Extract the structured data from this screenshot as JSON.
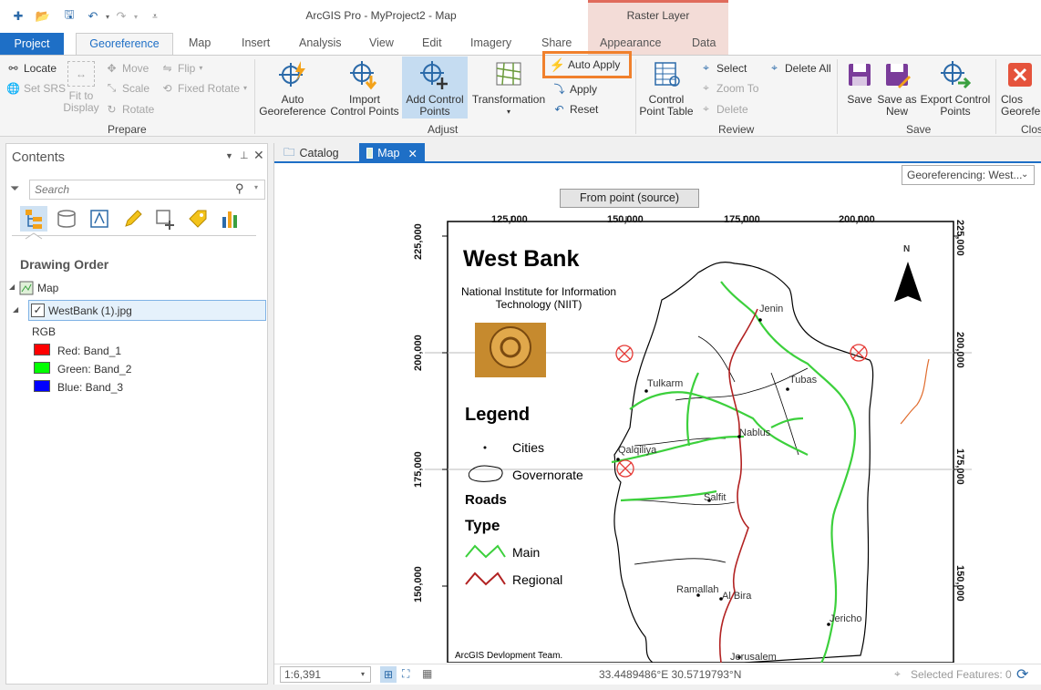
{
  "titlebar": {
    "title": "ArcGIS Pro - MyProject2 - Map",
    "context_group": "Raster Layer"
  },
  "tabs": {
    "project": "Project",
    "items": [
      "Georeference",
      "Map",
      "Insert",
      "Analysis",
      "View",
      "Edit",
      "Imagery",
      "Share",
      "Appearance",
      "Data"
    ]
  },
  "ribbon": {
    "prepare": {
      "label": "Prepare",
      "locate": "Locate",
      "set_srs": "Set SRS",
      "fit_line1": "Fit to",
      "fit_line2": "Display",
      "move": "Move",
      "scale": "Scale",
      "rotate": "Rotate",
      "flip": "Flip",
      "fixed_rotate": "Fixed Rotate"
    },
    "adjust": {
      "label": "Adjust",
      "auto_geo_1": "Auto",
      "auto_geo_2": "Georeference",
      "import_1": "Import",
      "import_2": "Control Points",
      "add_1": "Add Control",
      "add_2": "Points",
      "transformation": "Transformation",
      "auto_apply": "Auto Apply",
      "apply": "Apply",
      "reset": "Reset"
    },
    "review": {
      "label": "Review",
      "table_1": "Control",
      "table_2": "Point Table",
      "select": "Select",
      "zoom_to": "Zoom To",
      "delete": "Delete",
      "delete_all": "Delete All"
    },
    "save": {
      "label": "Save",
      "save": "Save",
      "save_new_1": "Save as",
      "save_new_2": "New",
      "export_1": "Export Control",
      "export_2": "Points"
    },
    "close": {
      "label": "Clos",
      "btn_1": "Clos",
      "btn_2": "Georefe"
    }
  },
  "contents": {
    "title": "Contents",
    "search_placeholder": "Search",
    "drawing_order": "Drawing Order",
    "map_node": "Map",
    "layer": "WestBank (1).jpg",
    "renderer": "RGB",
    "bands": [
      {
        "label": "Red:  Band_1",
        "color": "#ff0000"
      },
      {
        "label": "Green: Band_2",
        "color": "#00ff00"
      },
      {
        "label": "Blue:  Band_3",
        "color": "#0000ff"
      }
    ]
  },
  "mapview": {
    "tabs": [
      "Catalog",
      "Map"
    ],
    "dropdown": "Georeferencing: West...",
    "from_point": "From point (source)",
    "scale": "1:6,391",
    "coordinates": "33.4489486°E 30.5719793°N",
    "selected_features": "Selected Features: 0"
  },
  "map_image": {
    "title": "West Bank",
    "org": "National Institute for Information Technology (NIIT)",
    "legend_title": "Legend",
    "legend_cities": "Cities",
    "legend_gov": "Governorate",
    "legend_roads": "Roads",
    "legend_type": "Type",
    "legend_main": "Main",
    "legend_regional": "Regional",
    "credit": "ArcGIS Devlopment Team.",
    "north": "N",
    "x_ticks": [
      "125,000",
      "150,000",
      "175,000",
      "200,000"
    ],
    "y_ticks": [
      "225,000",
      "200,000",
      "175,000",
      "150,000"
    ],
    "cities": [
      "Jenin",
      "Tubas",
      "Tulkarm",
      "Nablus",
      "Qalqiliya",
      "Salfit",
      "Ramallah",
      "Al Bira",
      "Jericho",
      "Jerusalem"
    ]
  }
}
